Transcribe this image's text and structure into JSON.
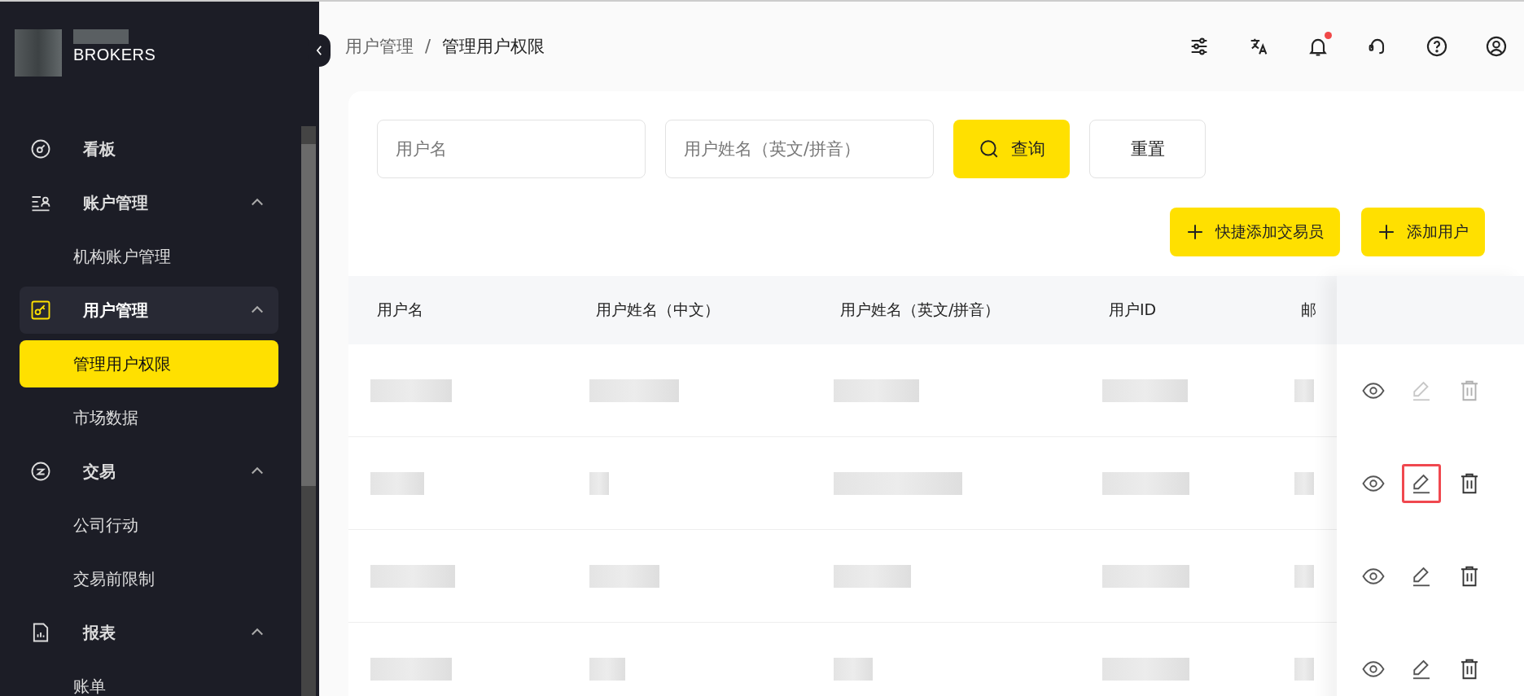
{
  "sidebar": {
    "brand": "BROKERS",
    "items": [
      {
        "label": "看板",
        "selected": false
      },
      {
        "label": "账户管理",
        "selected": false,
        "expanded": true,
        "children": [
          {
            "label": "机构账户管理",
            "selected": false
          }
        ]
      },
      {
        "label": "用户管理",
        "selected": true,
        "expanded": true,
        "children": [
          {
            "label": "管理用户权限",
            "selected": true
          },
          {
            "label": "市场数据",
            "selected": false
          }
        ]
      },
      {
        "label": "交易",
        "selected": false,
        "expanded": true,
        "children": [
          {
            "label": "公司行动",
            "selected": false
          },
          {
            "label": "交易前限制",
            "selected": false
          }
        ]
      },
      {
        "label": "报表",
        "selected": false,
        "expanded": true,
        "children": [
          {
            "label": "账单",
            "selected": false
          }
        ]
      }
    ]
  },
  "breadcrumb": {
    "items": [
      "用户管理",
      "管理用户权限"
    ],
    "separator": "/"
  },
  "header_icons": [
    {
      "badge": false
    },
    {
      "badge": false
    },
    {
      "badge": true
    },
    {
      "badge": false
    },
    {
      "badge": false
    },
    {
      "badge": false
    }
  ],
  "filters": {
    "fields": [
      {
        "placeholder": "用户名"
      },
      {
        "placeholder": "用户姓名（英文/拼音）"
      }
    ],
    "search_button": "查询",
    "reset_button": "重置"
  },
  "actions": [
    "快捷添加交易员",
    "添加用户"
  ],
  "table": {
    "columns": [
      "用户名",
      "用户姓名（中文）",
      "用户姓名（英文/拼音）",
      "用户ID",
      "邮"
    ],
    "rows": [
      {
        "edit_disabled": true,
        "highlighted": false
      },
      {
        "edit_disabled": false,
        "highlighted": true
      },
      {
        "edit_disabled": false,
        "highlighted": false
      },
      {
        "edit_disabled": false,
        "highlighted": false
      }
    ]
  }
}
